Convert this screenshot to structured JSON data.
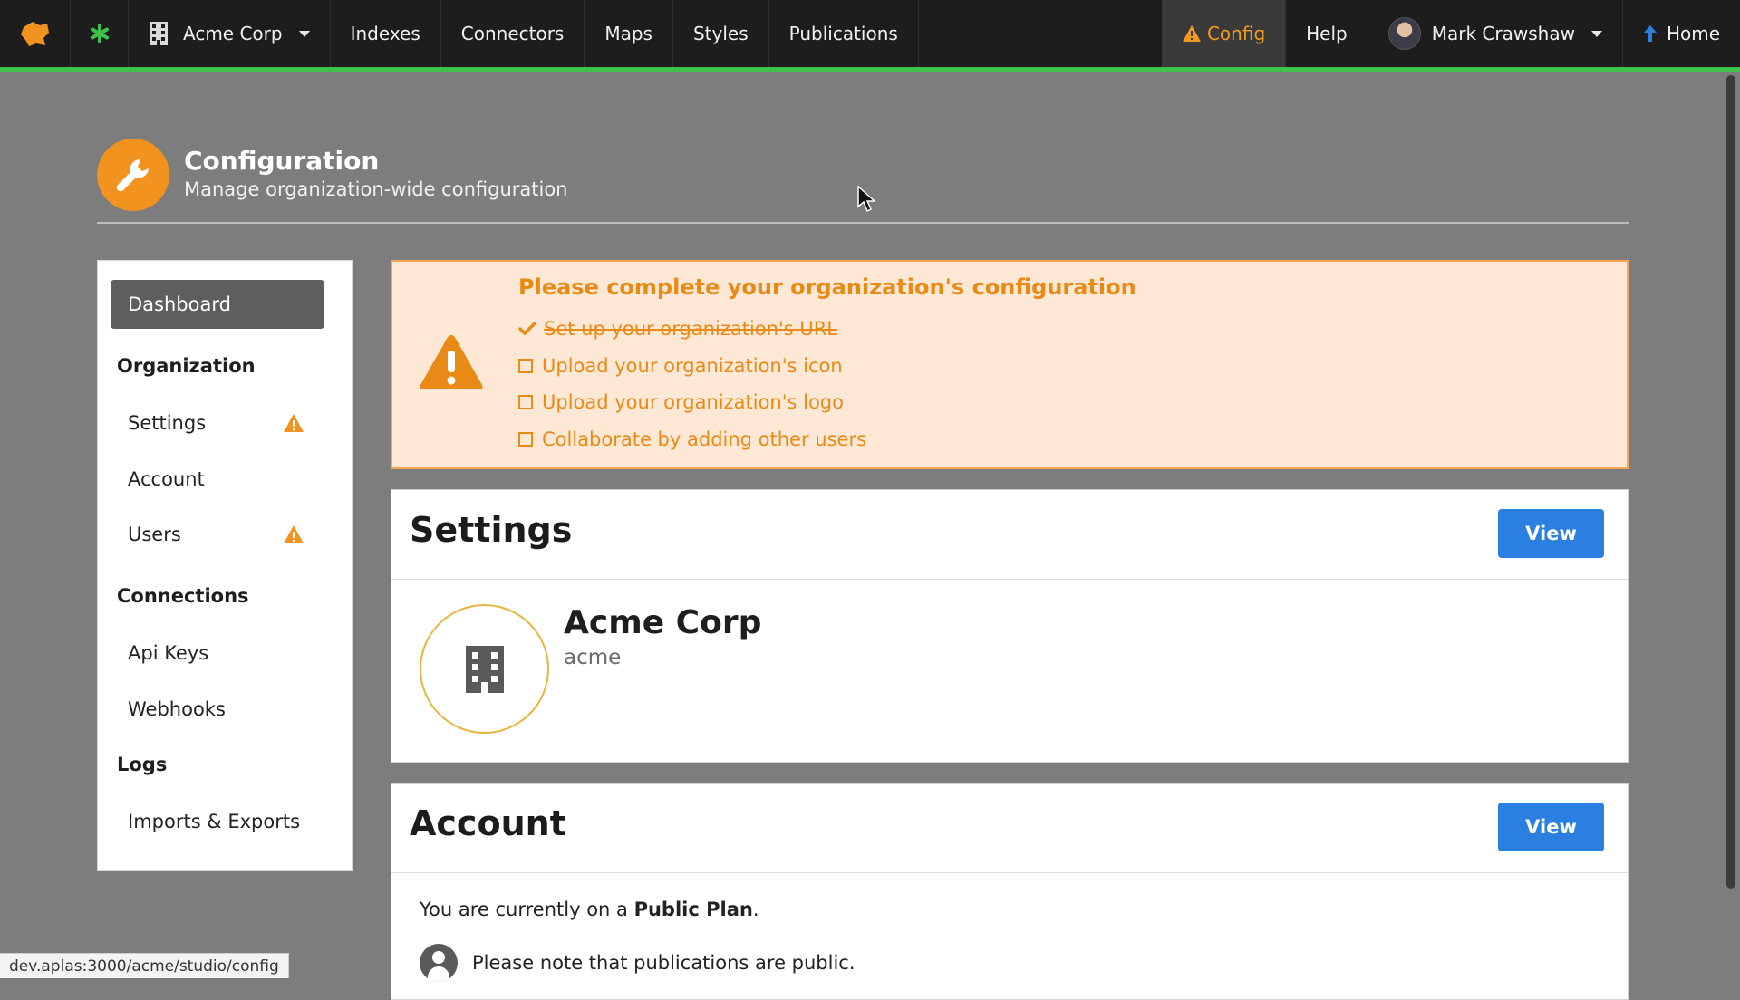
{
  "nav": {
    "org_label": "Acme Corp",
    "items": [
      "Indexes",
      "Connectors",
      "Maps",
      "Styles",
      "Publications"
    ],
    "config_label": "Config",
    "help_label": "Help",
    "user_name": "Mark Crawshaw",
    "home_label": "Home",
    "accent_color": "#3ec24b",
    "logo_color": "#f2921f",
    "star_color": "#3ec24b"
  },
  "header": {
    "title": "Configuration",
    "subtitle": "Manage organization-wide configuration"
  },
  "sidebar": {
    "dashboard": "Dashboard",
    "organization": {
      "heading": "Organization",
      "settings": "Settings",
      "account": "Account",
      "users": "Users"
    },
    "connections": {
      "heading": "Connections",
      "api_keys": "Api Keys",
      "webhooks": "Webhooks"
    },
    "logs": {
      "heading": "Logs",
      "imports_exports": "Imports & Exports"
    }
  },
  "alert": {
    "title": "Please complete your organization's configuration",
    "tasks": [
      {
        "label": "Set up your organization's URL",
        "done": true
      },
      {
        "label": "Upload your organization's icon",
        "done": false
      },
      {
        "label": "Upload your organization's logo",
        "done": false
      },
      {
        "label": "Collaborate by adding other users",
        "done": false
      }
    ],
    "color": "#ea8a16"
  },
  "settings_card": {
    "title": "Settings",
    "view_label": "View",
    "org_name": "Acme Corp",
    "org_slug": "acme"
  },
  "account_card": {
    "title": "Account",
    "view_label": "View",
    "plan_prefix": "You are currently on a ",
    "plan_name": "Public Plan",
    "plan_suffix": ".",
    "note": "Please note that publications are public."
  },
  "status_url": "dev.aplas:3000/acme/studio/config"
}
